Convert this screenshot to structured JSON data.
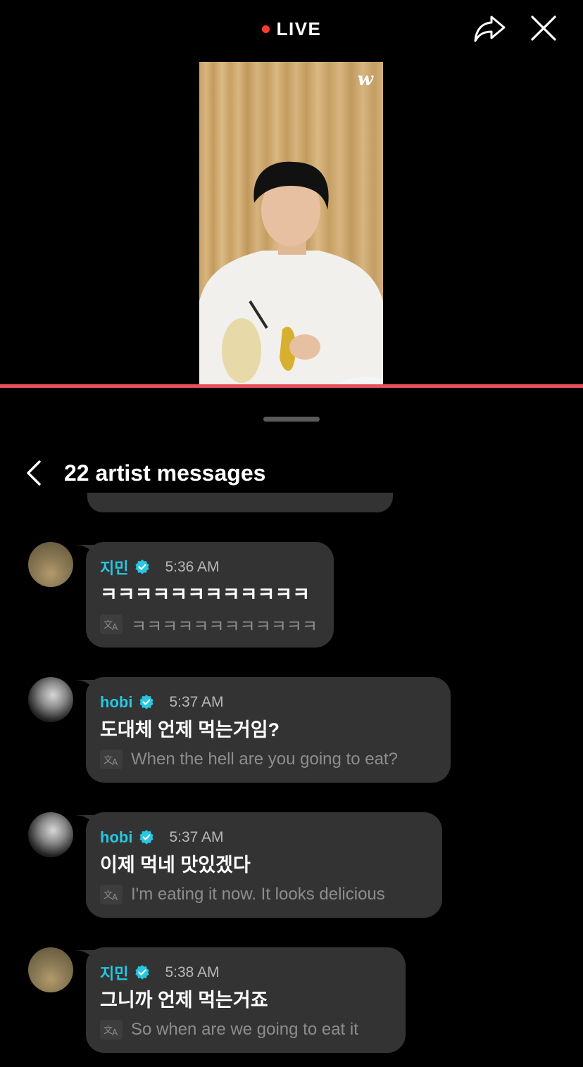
{
  "top_bar": {
    "live_label": "LIVE"
  },
  "video": {
    "watermark": "w"
  },
  "panel": {
    "title": "22 artist messages"
  },
  "messages": [
    {
      "author": "지민",
      "time": "5:36 AM",
      "original": "ㅋㅋㅋㅋㅋㅋㅋㅋㅋㅋㅋㅋ",
      "translation": "ㅋㅋㅋㅋㅋㅋㅋㅋㅋㅋㅋㅋ"
    },
    {
      "author": "hobi",
      "time": "5:37 AM",
      "original": "도대체 언제 먹는거임?",
      "translation": "When the hell are you going to eat?"
    },
    {
      "author": "hobi",
      "time": "5:37 AM",
      "original": "이제 먹네 맛있겠다",
      "translation": "I'm eating it now. It looks delicious"
    },
    {
      "author": "지민",
      "time": "5:38 AM",
      "original": "그니까 언제 먹는거죠",
      "translation": "So when are we going to eat it"
    }
  ],
  "colors": {
    "live_dot": "#ff3b2f",
    "progress": "#e8505b",
    "author_name": "#27c7e2",
    "bubble": "#333333",
    "verified_badge": "#27c7e2"
  },
  "icons": {
    "share": "share-icon",
    "close": "close-icon",
    "back": "chevron-left-icon",
    "verified": "verified-badge-icon",
    "translate": "translate-icon"
  }
}
